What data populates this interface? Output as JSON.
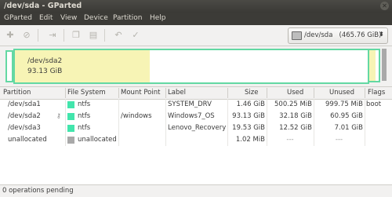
{
  "window": {
    "title": "/dev/sda - GParted"
  },
  "menu": [
    "GParted",
    "Edit",
    "View",
    "Device",
    "Partition",
    "Help"
  ],
  "toolbar": {
    "icons": [
      "new-icon",
      "delete-icon",
      "resize-move-icon",
      "copy-icon",
      "paste-icon",
      "undo-icon",
      "apply-icon"
    ],
    "device_label": "/dev/sda",
    "device_size": "(465.76 GiB)"
  },
  "graphic": {
    "selected_name": "/dev/sda2",
    "selected_size": "93.13 GiB",
    "colors": {
      "ntfs": "#42e5ac",
      "used": "#f7f4b5",
      "unallocated": "#a9a9a9",
      "border": "#63d8a3"
    }
  },
  "table": {
    "headers": [
      "Partition",
      "File System",
      "Mount Point",
      "Label",
      "Size",
      "Used",
      "Unused",
      "Flags"
    ],
    "rows": [
      {
        "partition": "/dev/sda1",
        "fs": "ntfs",
        "mount": "",
        "label": "SYSTEM_DRV",
        "size": "1.46 GiB",
        "used": "500.25 MiB",
        "unused": "999.75 MiB",
        "flags": "boot"
      },
      {
        "partition": "/dev/sda2",
        "fs": "ntfs",
        "mount": "/windows",
        "label": "Windows7_OS",
        "size": "93.13 GiB",
        "used": "32.18 GiB",
        "unused": "60.95 GiB",
        "flags": ""
      },
      {
        "partition": "/dev/sda3",
        "fs": "ntfs",
        "mount": "",
        "label": "Lenovo_Recovery",
        "size": "19.53 GiB",
        "used": "12.52 GiB",
        "unused": "7.01 GiB",
        "flags": ""
      },
      {
        "partition": "unallocated",
        "fs": "unallocated",
        "mount": "",
        "label": "",
        "size": "1.02 MiB",
        "used": "---",
        "unused": "---",
        "flags": ""
      }
    ]
  },
  "status": {
    "text": "0 operations pending"
  }
}
